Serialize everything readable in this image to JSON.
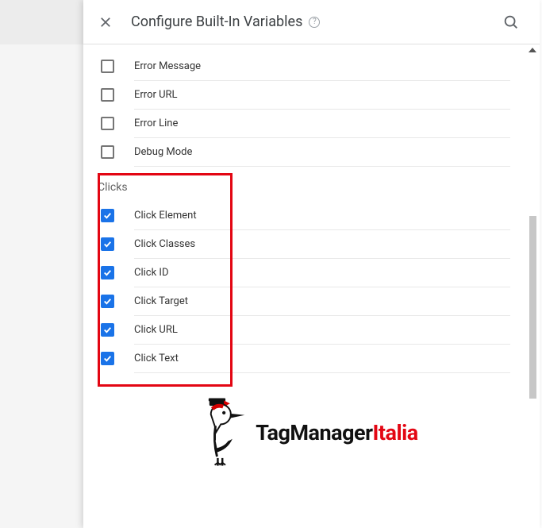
{
  "header": {
    "title": "Configure Built-In Variables"
  },
  "sections": [
    {
      "title": null,
      "items": [
        {
          "label": "Error Message",
          "checked": false
        },
        {
          "label": "Error URL",
          "checked": false
        },
        {
          "label": "Error Line",
          "checked": false
        },
        {
          "label": "Debug Mode",
          "checked": false
        }
      ]
    },
    {
      "title": "Clicks",
      "highlighted": true,
      "items": [
        {
          "label": "Click Element",
          "checked": true
        },
        {
          "label": "Click Classes",
          "checked": true
        },
        {
          "label": "Click ID",
          "checked": true
        },
        {
          "label": "Click Target",
          "checked": true
        },
        {
          "label": "Click URL",
          "checked": true
        },
        {
          "label": "Click Text",
          "checked": true
        }
      ]
    }
  ],
  "logo": {
    "text_black": "TagManager",
    "text_red": "Italia"
  }
}
